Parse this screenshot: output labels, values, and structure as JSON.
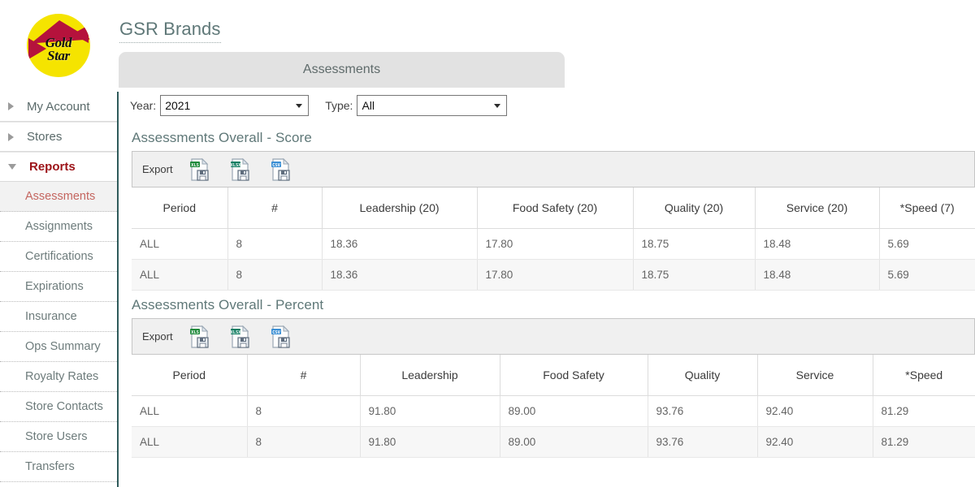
{
  "brand": {
    "logo_line1": "Gold",
    "logo_line2": "Star",
    "logo_bg": "#f5e400",
    "logo_accent": "#b5123c"
  },
  "header": {
    "title": "GSR Brands"
  },
  "tab": {
    "label": "Assessments"
  },
  "sidebar": {
    "top_items": [
      {
        "label": "My Account",
        "icon": "caret-right-icon",
        "expanded": false,
        "active": false
      },
      {
        "label": "Stores",
        "icon": "caret-right-icon",
        "expanded": false,
        "active": false
      },
      {
        "label": "Reports",
        "icon": "caret-down-icon",
        "expanded": true,
        "active": true
      }
    ],
    "sub_items": [
      {
        "label": "Assessments",
        "selected": true
      },
      {
        "label": "Assignments",
        "selected": false
      },
      {
        "label": "Certifications",
        "selected": false
      },
      {
        "label": "Expirations",
        "selected": false
      },
      {
        "label": "Insurance",
        "selected": false
      },
      {
        "label": "Ops Summary",
        "selected": false
      },
      {
        "label": "Royalty Rates",
        "selected": false
      },
      {
        "label": "Store Contacts",
        "selected": false
      },
      {
        "label": "Store Users",
        "selected": false
      },
      {
        "label": "Transfers",
        "selected": false
      }
    ]
  },
  "filters": {
    "year_label": "Year:",
    "year_value": "2021",
    "type_label": "Type:",
    "type_value": "All"
  },
  "export": {
    "label": "Export",
    "icons": [
      {
        "name": "export-xls-icon",
        "tag": "XLS",
        "color": "#1f8a3b"
      },
      {
        "name": "export-xlsx-icon",
        "tag": "XLSX",
        "color": "#127d62"
      },
      {
        "name": "export-csv-icon",
        "tag": "CSV",
        "color": "#3b8fd4"
      }
    ]
  },
  "sections": [
    {
      "title": "Assessments Overall - Score",
      "columns": [
        "Period",
        "#",
        "Leadership (20)",
        "Food Safety (20)",
        "Quality (20)",
        "Service (20)",
        "*Speed (7)"
      ],
      "rows": [
        [
          "ALL",
          "8",
          "18.36",
          "17.80",
          "18.75",
          "18.48",
          "5.69"
        ],
        [
          "ALL",
          "8",
          "18.36",
          "17.80",
          "18.75",
          "18.48",
          "5.69"
        ]
      ]
    },
    {
      "title": "Assessments Overall - Percent",
      "columns": [
        "Period",
        "#",
        "Leadership",
        "Food Safety",
        "Quality",
        "Service",
        "*Speed"
      ],
      "rows": [
        [
          "ALL",
          "8",
          "91.80",
          "89.00",
          "93.76",
          "92.40",
          "81.29"
        ],
        [
          "ALL",
          "8",
          "91.80",
          "89.00",
          "93.76",
          "92.40",
          "81.29"
        ]
      ]
    }
  ],
  "colors": {
    "sidebar_border": "#2f5b5b",
    "title_text": "#5f7878",
    "active_nav": "#9c1318",
    "selected_nav": "#c4655f",
    "tab_bg": "#e2e2e2",
    "export_bg": "#f0f0f0"
  }
}
